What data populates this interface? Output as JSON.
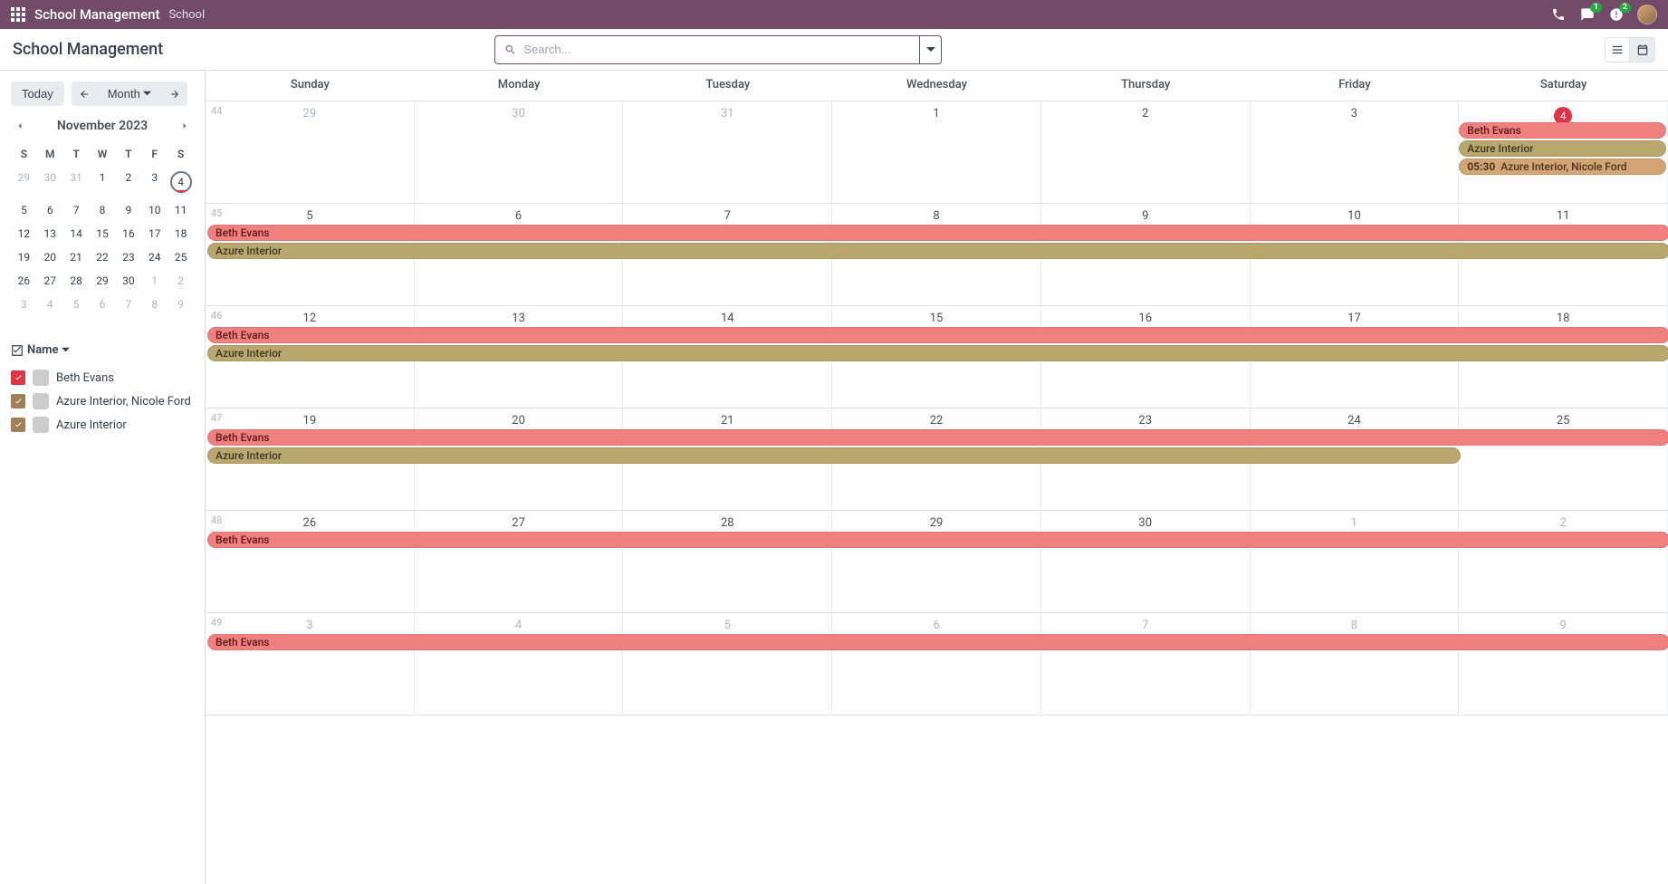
{
  "app": {
    "brand": "School Management",
    "section": "School",
    "badges": {
      "chat": "1",
      "activity": "2"
    }
  },
  "page": {
    "title": "School Management",
    "search_placeholder": "Search..."
  },
  "controls": {
    "today_label": "Today",
    "scale_label": "Month"
  },
  "mini_calendar": {
    "title": "November 2023",
    "dow": [
      "S",
      "M",
      "T",
      "W",
      "T",
      "F",
      "S"
    ],
    "rows": [
      [
        {
          "n": "29",
          "m": true
        },
        {
          "n": "30",
          "m": true
        },
        {
          "n": "31",
          "m": true
        },
        {
          "n": "1"
        },
        {
          "n": "2"
        },
        {
          "n": "3"
        },
        {
          "n": "4",
          "sel": true
        }
      ],
      [
        {
          "n": "5"
        },
        {
          "n": "6"
        },
        {
          "n": "7"
        },
        {
          "n": "8"
        },
        {
          "n": "9"
        },
        {
          "n": "10"
        },
        {
          "n": "11"
        }
      ],
      [
        {
          "n": "12"
        },
        {
          "n": "13"
        },
        {
          "n": "14"
        },
        {
          "n": "15"
        },
        {
          "n": "16"
        },
        {
          "n": "17"
        },
        {
          "n": "18"
        }
      ],
      [
        {
          "n": "19"
        },
        {
          "n": "20"
        },
        {
          "n": "21"
        },
        {
          "n": "22"
        },
        {
          "n": "23"
        },
        {
          "n": "24"
        },
        {
          "n": "25"
        }
      ],
      [
        {
          "n": "26"
        },
        {
          "n": "27"
        },
        {
          "n": "28"
        },
        {
          "n": "29"
        },
        {
          "n": "30"
        },
        {
          "n": "1",
          "m": true
        },
        {
          "n": "2",
          "m": true
        }
      ],
      [
        {
          "n": "3",
          "m": true
        },
        {
          "n": "4",
          "m": true
        },
        {
          "n": "5",
          "m": true
        },
        {
          "n": "6",
          "m": true
        },
        {
          "n": "7",
          "m": true
        },
        {
          "n": "8",
          "m": true
        },
        {
          "n": "9",
          "m": true
        }
      ]
    ]
  },
  "filters": {
    "header": "Name",
    "items": [
      {
        "label": "Beth Evans",
        "color": "#dc3545"
      },
      {
        "label": "Azure Interior, Nicole Ford",
        "color": "#a08058"
      },
      {
        "label": "Azure Interior",
        "color": "#a08058"
      }
    ]
  },
  "calendar": {
    "dow": [
      "Sunday",
      "Monday",
      "Tuesday",
      "Wednesday",
      "Thursday",
      "Friday",
      "Saturday"
    ],
    "weeks": [
      {
        "num": "44",
        "days": [
          {
            "n": "29",
            "m": true
          },
          {
            "n": "30",
            "m": true
          },
          {
            "n": "31",
            "m": true
          },
          {
            "n": "1"
          },
          {
            "n": "2"
          },
          {
            "n": "3"
          },
          {
            "n": "4",
            "today": true
          }
        ],
        "events_first": [
          {
            "label": "Beth Evans",
            "cls": "ev-red"
          },
          {
            "label": "Azure Interior",
            "cls": "ev-olive"
          },
          {
            "time": "05:30",
            "label": "Azure Interior, Nicole Ford",
            "cls": "ev-brown"
          }
        ]
      },
      {
        "num": "45",
        "days": [
          {
            "n": "5"
          },
          {
            "n": "6"
          },
          {
            "n": "7"
          },
          {
            "n": "8"
          },
          {
            "n": "9"
          },
          {
            "n": "10"
          },
          {
            "n": "11"
          }
        ],
        "events": [
          {
            "label": "Beth Evans",
            "cls": "ev-red",
            "span": 7
          },
          {
            "label": "Azure Interior",
            "cls": "ev-olive",
            "span": 7
          }
        ]
      },
      {
        "num": "46",
        "days": [
          {
            "n": "12"
          },
          {
            "n": "13"
          },
          {
            "n": "14"
          },
          {
            "n": "15"
          },
          {
            "n": "16"
          },
          {
            "n": "17"
          },
          {
            "n": "18"
          }
        ],
        "events": [
          {
            "label": "Beth Evans",
            "cls": "ev-red",
            "span": 7
          },
          {
            "label": "Azure Interior",
            "cls": "ev-olive",
            "span": 7
          }
        ]
      },
      {
        "num": "47",
        "days": [
          {
            "n": "19"
          },
          {
            "n": "20"
          },
          {
            "n": "21"
          },
          {
            "n": "22"
          },
          {
            "n": "23"
          },
          {
            "n": "24"
          },
          {
            "n": "25"
          }
        ],
        "events": [
          {
            "label": "Beth Evans",
            "cls": "ev-red",
            "span": 7
          },
          {
            "label": "Azure Interior",
            "cls": "ev-olive",
            "span": 6
          }
        ]
      },
      {
        "num": "48",
        "days": [
          {
            "n": "26"
          },
          {
            "n": "27"
          },
          {
            "n": "28"
          },
          {
            "n": "29"
          },
          {
            "n": "30"
          },
          {
            "n": "1",
            "m": true
          },
          {
            "n": "2",
            "m": true
          }
        ],
        "events": [
          {
            "label": "Beth Evans",
            "cls": "ev-red",
            "span": 7
          }
        ]
      },
      {
        "num": "49",
        "days": [
          {
            "n": "3",
            "m": true
          },
          {
            "n": "4",
            "m": true
          },
          {
            "n": "5",
            "m": true
          },
          {
            "n": "6",
            "m": true
          },
          {
            "n": "7",
            "m": true
          },
          {
            "n": "8",
            "m": true
          },
          {
            "n": "9",
            "m": true
          }
        ],
        "events": [
          {
            "label": "Beth Evans",
            "cls": "ev-red",
            "span": 7
          }
        ]
      }
    ]
  }
}
